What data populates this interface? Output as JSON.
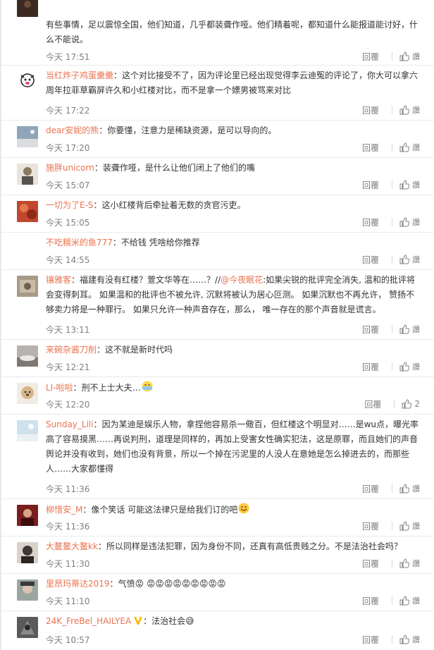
{
  "ui": {
    "reply_label": "回覆",
    "like_label": "讚"
  },
  "comments": [
    {
      "user": "",
      "text": "有些事情，足以震惊全国，他们知道，几乎都装聋作哑。他们精着呢，都知道什么能报道能讨好，什么不能说。",
      "time": "今天 17:51",
      "likes": "",
      "avatar": "#3a2a22"
    },
    {
      "user": "当红炸子鸡蛋羹羹",
      "text": "这个对比接受不了，因为评论里已经出现觉得李云迪冤的评论了，你大可以拿六周年拉菲草霸屏许久和小红楼对比，而不是拿一个嫖男被骂来对比",
      "time": "今天 17:22",
      "likes": "",
      "avatar": "#c9c9c9"
    },
    {
      "user": "dear安妮的熊",
      "text": "你要懂，注意力是稀缺资源，是可以导向的。",
      "time": "今天 17:20",
      "likes": "",
      "avatar": "#8fa6b8"
    },
    {
      "user": "施胖unicorn",
      "text": "装聋作哑，是什么让他们闭上了他们的嘴",
      "time": "今天 15:07",
      "likes": "",
      "avatar": "#8c7a5e"
    },
    {
      "user": "一切为了E-S",
      "text": "这小红楼背后牵扯着无数的贪官污吏。",
      "time": "今天 15:05",
      "likes": "",
      "avatar": "#c0462e"
    },
    {
      "user": "不吃糯米的鱼777",
      "text": "不给钱 凭啥给你推荐",
      "time": "今天 14:55",
      "likes": "",
      "avatar": ""
    },
    {
      "user": "镶雅客",
      "text_before": "福建有没有红楼？萱文华等在……？//",
      "at": "@今夜眠花",
      "text_after": ":如果尖锐的批评完全消失, 温和的批评将会变得刺耳。 如果温和的批评也不被允许, 沉默将被认为居心叵测。 如果沉默也不再允许， 赞扬不够卖力将是一种罪行。 如果只允许一种声音存在，那么， 唯一存在的那个声音就是谎言。",
      "time": "今天 13:11",
      "likes": "",
      "avatar": "#a89a86"
    },
    {
      "user": "来碗杂酱刀削",
      "text": "这不就是新时代吗",
      "time": "今天 12:21",
      "likes": "",
      "avatar": "#b7b2ad"
    },
    {
      "user": "LI-啦啦",
      "text": "刑不上士大夫…",
      "time": "今天 12:20",
      "likes": "2",
      "avatar": "#d7b58a"
    },
    {
      "user": "Sunday_Lili",
      "text": "因为某迪是娱乐人物，拿捏他容易杀一儆百，但红楼这个明显对……是wu点，曝光率高了容易摸黑……再说判刑，道理是同样的，再加上受害女性确实犯法，这是原罪，而且她们的声音舆论并没有收到，她们也没有背景，所以一个掉在污泥里的人没人在意她是怎么掉进去的，而那些人……大家都懂得",
      "time": "今天 11:36",
      "likes": "",
      "avatar": "#cde2ec"
    },
    {
      "user": "柳惜安_M",
      "text": "像个笑话 可能这法律只是给我们订的吧",
      "time": "今天 11:36",
      "likes": "",
      "avatar": "#7a1e1e"
    },
    {
      "user": "大鳌鳌大鳌kk",
      "text": "所以同样是违法犯罪，因为身份不同，还真有高低贵贱之分。不是法治社会吗？",
      "time": "今天 11:30",
      "likes": "",
      "avatar": "#3d3835"
    },
    {
      "user": "里昂玛蒂达2019",
      "text": "气愤😡 😡😡😡😡😡😡😡😡😡",
      "time": "今天 11:10",
      "likes": "",
      "avatar": "#9aa6a0"
    },
    {
      "user": "24K_FreBel_HAILYEA",
      "text": "法治社会😅",
      "time": "今天 10:57",
      "likes": "",
      "avatar": "#5a5a5a"
    }
  ]
}
